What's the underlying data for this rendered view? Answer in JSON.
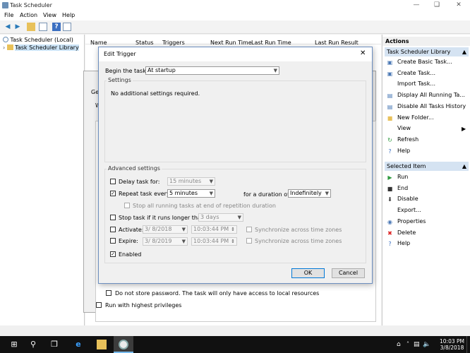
{
  "window": {
    "title": "Task Scheduler"
  },
  "menu": [
    "File",
    "Action",
    "View",
    "Help"
  ],
  "tree": {
    "root": "Task Scheduler (Local)",
    "library": "Task Scheduler Library"
  },
  "columns": [
    "Name",
    "Status",
    "Triggers",
    "Next Run Time",
    "Last Run Time",
    "Last Run Result"
  ],
  "background_dialog": {
    "tab_fragment": "Ger",
    "w_fragment": "W",
    "store_password": "Do not store password. The task will only have access to local resources",
    "highest_privileges": "Run with highest privileges"
  },
  "actions": {
    "header": "Actions",
    "section1": "Task Scheduler Library",
    "items1": [
      {
        "label": "Create Basic Task...",
        "icon": "create-basic-task-icon"
      },
      {
        "label": "Create Task...",
        "icon": "create-task-icon"
      },
      {
        "label": "Import Task...",
        "icon": ""
      },
      {
        "label": "Display All Running Ta...",
        "icon": "running-tasks-icon"
      },
      {
        "label": "Disable All Tasks History",
        "icon": "history-icon"
      },
      {
        "label": "New Folder...",
        "icon": "folder-icon"
      },
      {
        "label": "View",
        "icon": ""
      },
      {
        "label": "Refresh",
        "icon": "refresh-icon"
      },
      {
        "label": "Help",
        "icon": "help-icon"
      }
    ],
    "section2": "Selected Item",
    "items2": [
      {
        "label": "Run",
        "icon": "run-icon"
      },
      {
        "label": "End",
        "icon": "end-icon"
      },
      {
        "label": "Disable",
        "icon": "disable-icon"
      },
      {
        "label": "Export...",
        "icon": ""
      },
      {
        "label": "Properties",
        "icon": "properties-icon"
      },
      {
        "label": "Delete",
        "icon": "delete-icon"
      },
      {
        "label": "Help",
        "icon": "help-icon"
      }
    ]
  },
  "dialog": {
    "title": "Edit Trigger",
    "begin_label": "Begin the task:",
    "begin_value": "At startup",
    "settings_label": "Settings",
    "settings_text": "No additional settings required.",
    "advanced_label": "Advanced settings",
    "delay_label": "Delay task for:",
    "delay_value": "15 minutes",
    "repeat_label": "Repeat task every:",
    "repeat_value": "5 minutes",
    "duration_label": "for a duration of:",
    "duration_value": "Indefinitely",
    "stop_running_label": "Stop all running tasks at end of repetition duration",
    "stop_longer_label": "Stop task if it runs longer than:",
    "stop_longer_value": "3 days",
    "activate_label": "Activate:",
    "activate_date": "3/  8/2018",
    "activate_time": "10:03:44 PM",
    "expire_label": "Expire:",
    "expire_date": "3/  8/2019",
    "expire_time": "10:03:44 PM",
    "sync_label": "Synchronize across time zones",
    "enabled_label": "Enabled",
    "ok": "OK",
    "cancel": "Cancel"
  },
  "taskbar": {
    "time": "10:03 PM",
    "date": "3/8/2018"
  }
}
